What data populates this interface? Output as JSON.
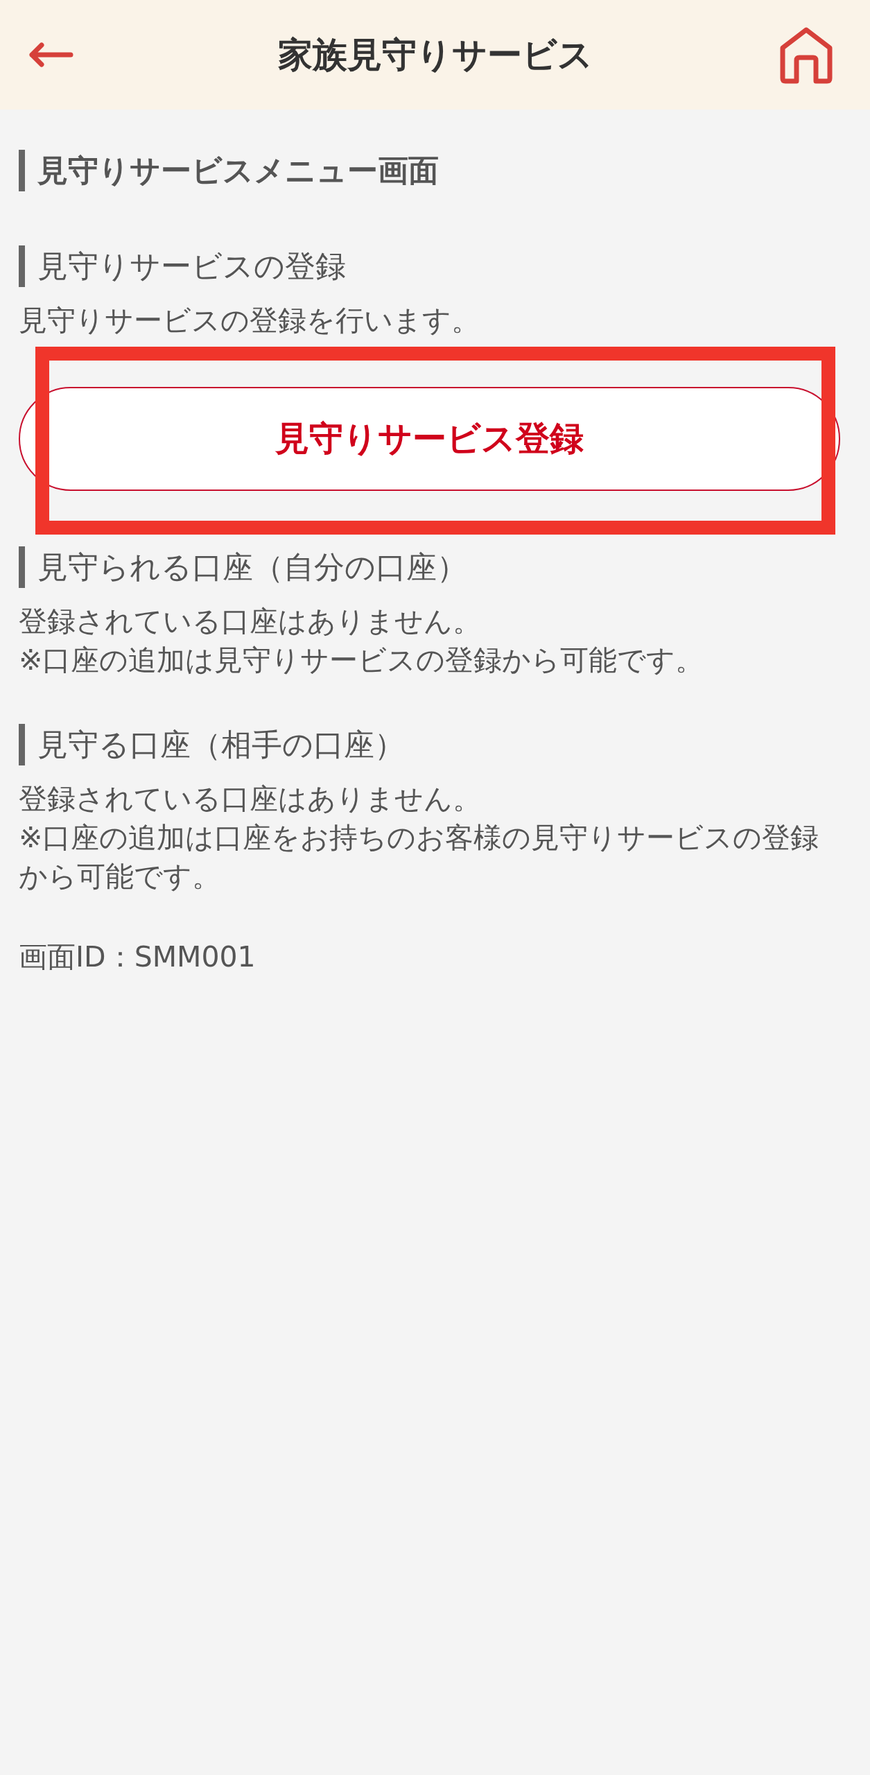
{
  "header": {
    "title": "家族見守りサービス"
  },
  "page_heading": "見守りサービスメニュー画面",
  "sections": [
    {
      "heading": "見守りサービスの登録",
      "lines": [
        "見守りサービスの登録を行います。"
      ],
      "button": {
        "label": "見守りサービス登録",
        "highlighted": true
      }
    },
    {
      "heading": "見守られる口座（自分の口座）",
      "lines": [
        "登録されている口座はありません。",
        "※口座の追加は見守りサービスの登録から可能です。"
      ]
    },
    {
      "heading": "見守る口座（相手の口座）",
      "lines": [
        "登録されている口座はありません。",
        "※口座の追加は口座をお持ちのお客様の見守りサービスの登録から可能です。"
      ]
    }
  ],
  "screen_id": "画面ID：SMM001"
}
